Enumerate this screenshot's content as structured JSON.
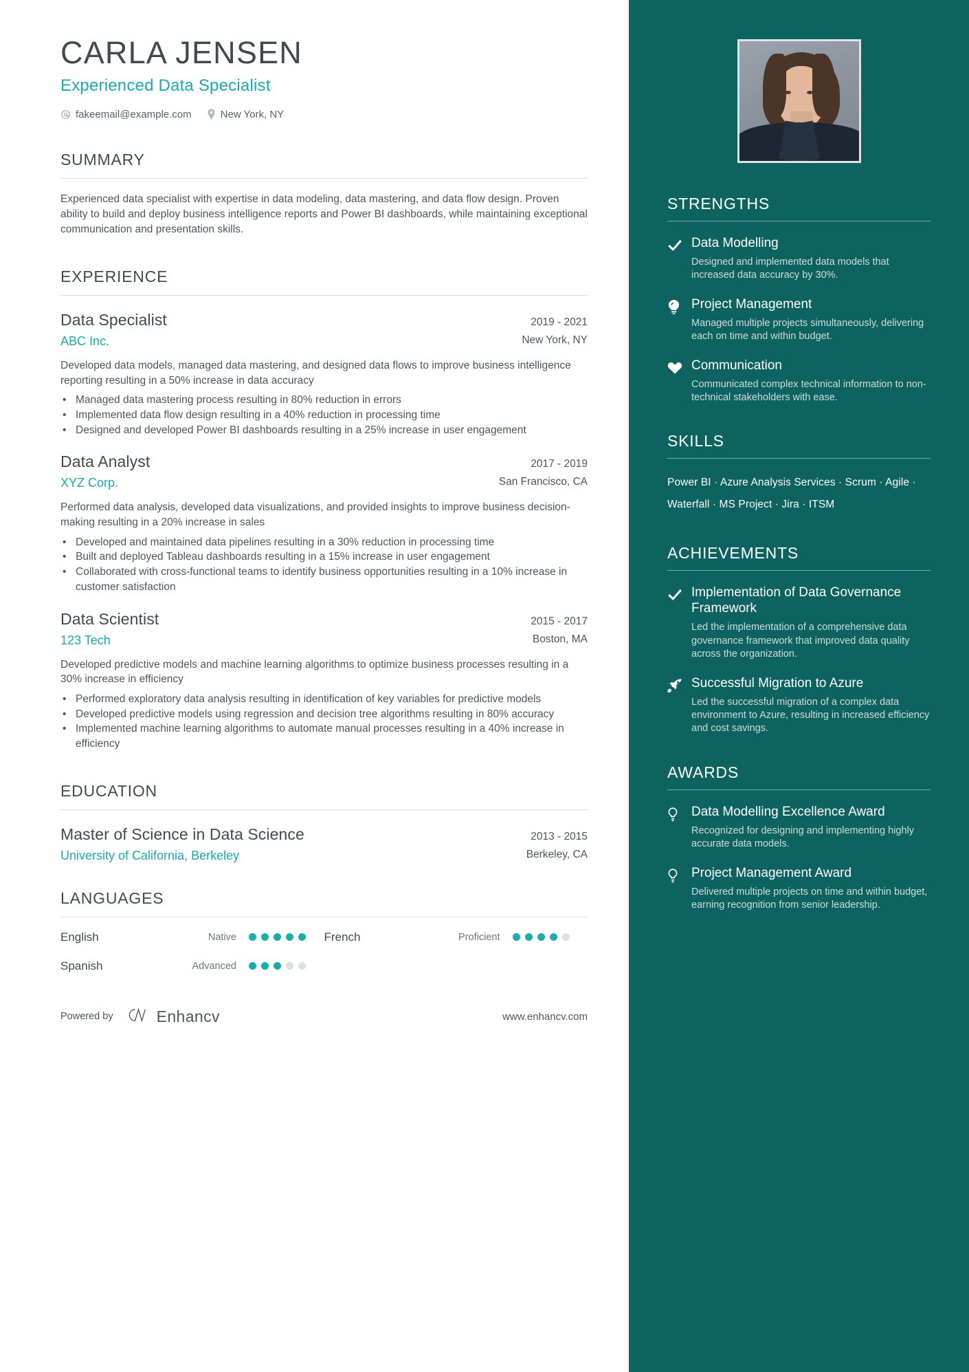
{
  "header": {
    "name": "CARLA JENSEN",
    "job_title": "Experienced Data Specialist",
    "email": "fakeemail@example.com",
    "location": "New York, NY",
    "email_icon": "at-sign-icon",
    "location_icon": "map-pin-icon"
  },
  "colors": {
    "accent_teal": "#1aacac",
    "sidebar_bg": "#0c6360",
    "heading": "#3f4a51",
    "body_text": "#4c565e",
    "rule": "#d7dbde"
  },
  "summary": {
    "title": "SUMMARY",
    "text": "Experienced data specialist with expertise in data modeling, data mastering, and data flow design. Proven ability to build and deploy business intelligence reports and Power BI dashboards, while maintaining exceptional communication and presentation skills."
  },
  "experience": {
    "title": "EXPERIENCE",
    "jobs": [
      {
        "role": "Data Specialist",
        "company": "ABC Inc.",
        "dates": "2019 - 2021",
        "location": "New York, NY",
        "description": "Developed data models, managed data mastering, and designed data flows to improve business intelligence reporting resulting in a 50% increase in data accuracy",
        "bullets": [
          "Managed data mastering process resulting in 80% reduction in errors",
          "Implemented data flow design resulting in a 40% reduction in processing time",
          "Designed and developed Power BI dashboards resulting in a 25% increase in user engagement"
        ]
      },
      {
        "role": "Data Analyst",
        "company": "XYZ Corp.",
        "dates": "2017 - 2019",
        "location": "San Francisco, CA",
        "description": "Performed data analysis, developed data visualizations, and provided insights to improve business decision-making resulting in a 20% increase in sales",
        "bullets": [
          "Developed and maintained data pipelines resulting in a 30% reduction in processing time",
          "Built and deployed Tableau dashboards resulting in a 15% increase in user engagement",
          "Collaborated with cross-functional teams to identify business opportunities resulting in a 10% increase in customer satisfaction"
        ]
      },
      {
        "role": "Data Scientist",
        "company": "123 Tech",
        "dates": "2015 - 2017",
        "location": "Boston, MA",
        "description": "Developed predictive models and machine learning algorithms to optimize business processes resulting in a 30% increase in efficiency",
        "bullets": [
          "Performed exploratory data analysis resulting in identification of key variables for predictive models",
          "Developed predictive models using regression and decision tree algorithms resulting in 80% accuracy",
          "Implemented machine learning algorithms to automate manual processes resulting in a 40% increase in efficiency"
        ]
      }
    ]
  },
  "education": {
    "title": "EDUCATION",
    "entries": [
      {
        "degree": "Master of Science in Data Science",
        "school": "University of California, Berkeley",
        "dates": "2013 - 2015",
        "location": "Berkeley, CA"
      }
    ]
  },
  "languages": {
    "title": "LANGUAGES",
    "items": [
      {
        "name": "English",
        "level": "Native",
        "rating": 5,
        "max": 5
      },
      {
        "name": "French",
        "level": "Proficient",
        "rating": 4,
        "max": 5
      },
      {
        "name": "Spanish",
        "level": "Advanced",
        "rating": 3,
        "max": 5
      }
    ]
  },
  "footer": {
    "powered_by": "Powered by",
    "brand": "Enhancv",
    "brand_icon": "enhancv-logo-icon",
    "website": "www.enhancv.com"
  },
  "strengths": {
    "title": "STRENGTHS",
    "items": [
      {
        "icon": "check-icon",
        "title": "Data Modelling",
        "description": "Designed and implemented data models that increased data accuracy by 30%."
      },
      {
        "icon": "lightbulb-head-icon",
        "title": "Project Management",
        "description": "Managed multiple projects simultaneously, delivering each on time and within budget."
      },
      {
        "icon": "heart-icon",
        "title": "Communication",
        "description": "Communicated complex technical information to non-technical stakeholders with ease."
      }
    ]
  },
  "skills": {
    "title": "SKILLS",
    "items": [
      "Power BI",
      "Azure Analysis Services",
      "Scrum",
      "Agile",
      "Waterfall",
      "MS Project",
      "Jira",
      "ITSM"
    ],
    "separator": " · ",
    "text": "Power BI · Azure Analysis Services · Scrum · Agile · Waterfall · MS Project · Jira · ITSM"
  },
  "achievements": {
    "title": "ACHIEVEMENTS",
    "items": [
      {
        "icon": "check-icon",
        "title": "Implementation of Data Governance Framework",
        "description": "Led the implementation of a comprehensive data governance framework that improved data quality across the organization."
      },
      {
        "icon": "rocket-icon",
        "title": "Successful Migration to Azure",
        "description": "Led the successful migration of a complex data environment to Azure, resulting in increased efficiency and cost savings."
      }
    ]
  },
  "awards": {
    "title": "AWARDS",
    "items": [
      {
        "icon": "bulb-icon",
        "title": "Data Modelling Excellence Award",
        "description": "Recognized for designing and implementing highly accurate data models."
      },
      {
        "icon": "bulb-icon",
        "title": "Project Management Award",
        "description": "Delivered multiple projects on time and within budget, earning recognition from senior leadership."
      }
    ]
  }
}
